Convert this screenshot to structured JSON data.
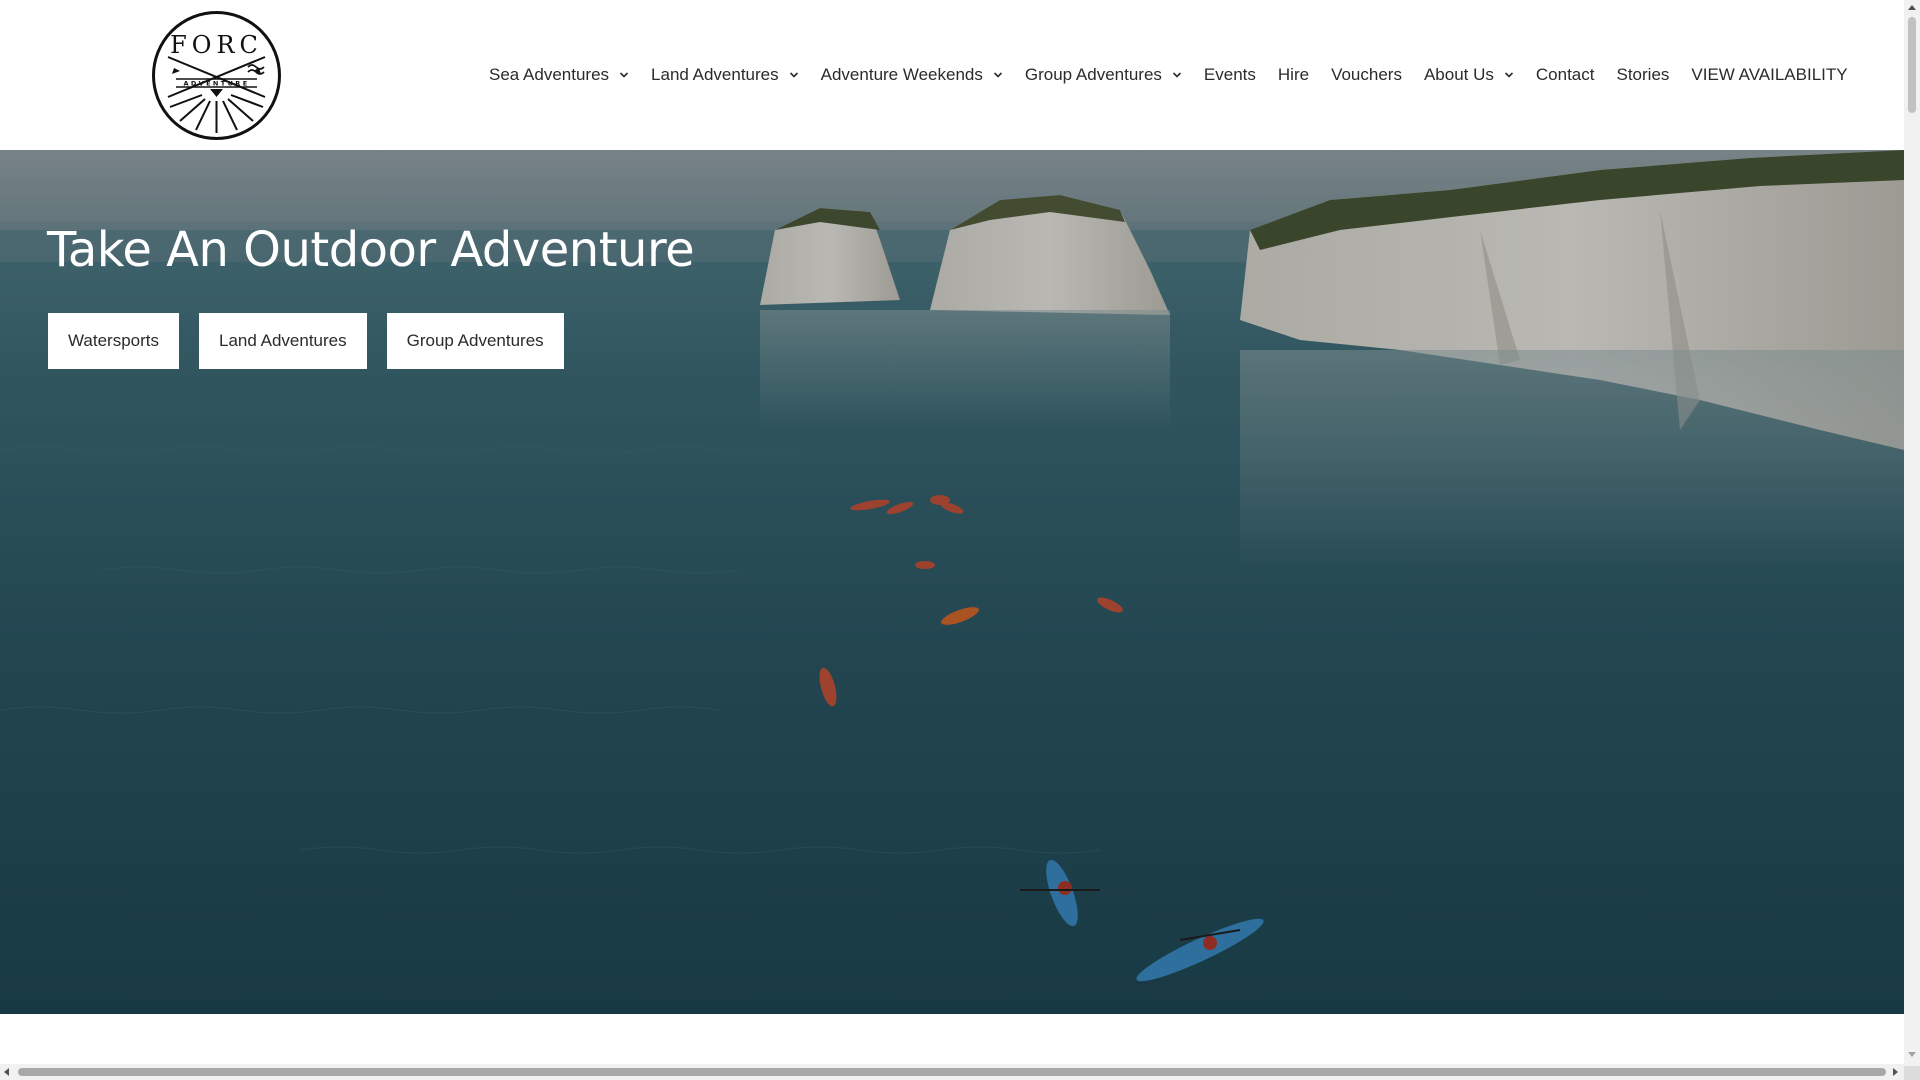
{
  "brand": {
    "logo_letters": [
      "F",
      "O",
      "R",
      "C"
    ],
    "logo_subtext": "ADVENTURE"
  },
  "nav": {
    "items": [
      {
        "label": "Sea Adventures",
        "dropdown": true
      },
      {
        "label": "Land Adventures",
        "dropdown": true
      },
      {
        "label": "Adventure Weekends",
        "dropdown": true
      },
      {
        "label": "Group Adventures",
        "dropdown": true
      },
      {
        "label": "Events",
        "dropdown": false
      },
      {
        "label": "Hire",
        "dropdown": false
      },
      {
        "label": "Vouchers",
        "dropdown": false
      },
      {
        "label": "About Us",
        "dropdown": true
      },
      {
        "label": "Contact",
        "dropdown": false
      },
      {
        "label": "Stories",
        "dropdown": false
      },
      {
        "label": "VIEW AVAILABILITY",
        "dropdown": false
      }
    ]
  },
  "hero": {
    "title": "Take An Outdoor Adventure",
    "buttons": [
      "Watersports",
      "Land Adventures",
      "Group Adventures"
    ]
  },
  "colors": {
    "header_bg": "#ffffff",
    "nav_text": "#2b2b2b",
    "sea": "#2e5a66",
    "cliff": "#e8e6df",
    "button_bg": "#ffffff"
  }
}
